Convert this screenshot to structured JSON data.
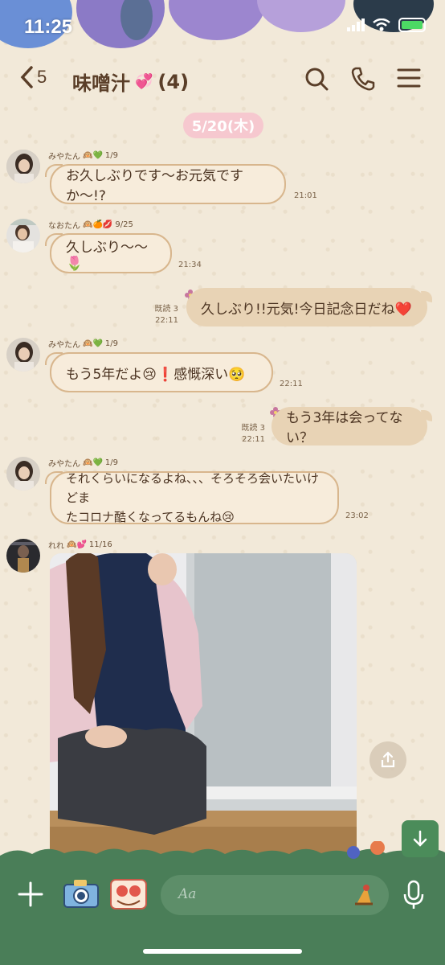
{
  "status": {
    "time": "11:25"
  },
  "header": {
    "back_count": "5",
    "title": "味噌汁",
    "title_emoji": "💞",
    "member_count": "(4)"
  },
  "date_divider": "5/20(木)",
  "messages": [
    {
      "type": "in",
      "sender": "みやたん",
      "sender_emoji": "🙉💚",
      "sender_date": "1/9",
      "text": "お久しぶりです〜お元気ですか〜!?",
      "time": "21:01"
    },
    {
      "type": "in",
      "sender": "なおたん",
      "sender_emoji": "🙉🍊💋",
      "sender_date": "9/25",
      "text": "久しぶり〜〜🌷",
      "time": "21:34"
    },
    {
      "type": "out",
      "read": "既読 3",
      "time": "22:11",
      "text": "久しぶり!!元気!今日記念日だね❤️"
    },
    {
      "type": "in",
      "sender": "みやたん",
      "sender_emoji": "🙉💚",
      "sender_date": "1/9",
      "text": "もう5年だよ😢❗️感慨深い🥺",
      "time": "22:11"
    },
    {
      "type": "out",
      "read": "既読 3",
      "time": "22:11",
      "text": "もう3年は会ってない？"
    },
    {
      "type": "in",
      "sender": "みやたん",
      "sender_emoji": "🙉💚",
      "sender_date": "1/9",
      "text_line1": "それくらいになるよね、、、そろそろ会いたいけどま",
      "text_line2": "たコロナ酷くなってるもんね😢",
      "time": "23:02"
    },
    {
      "type": "photo",
      "sender": "れれ",
      "sender_emoji": "🙉💕",
      "sender_date": "11/16"
    }
  ],
  "input": {
    "placeholder": "Aa"
  },
  "colors": {
    "bottom_bar": "#4a7e58",
    "date_pill": "#f6c8cf",
    "bubble_border": "#d8b68d",
    "bubble_out": "#e8d3b5"
  }
}
